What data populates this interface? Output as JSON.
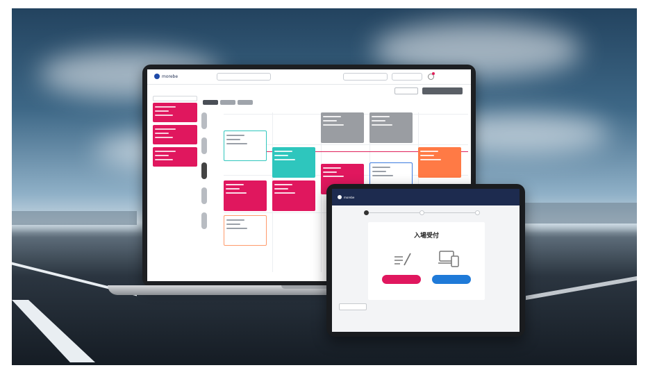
{
  "laptop_app": {
    "brand": "morebe",
    "header": {
      "date": "",
      "select_1": "",
      "select_2": "",
      "user": ""
    },
    "sidebar": {
      "title": ""
    },
    "main": {
      "title": "",
      "link": "",
      "btn_1": "",
      "btn_2": "",
      "link_right": ""
    },
    "day_headers": [
      "",
      "",
      "",
      "",
      ""
    ],
    "time_labels": [
      "",
      "",
      "",
      ""
    ]
  },
  "tablet_app": {
    "brand": "morebe",
    "nav": [
      "",
      ""
    ],
    "steps": [
      "",
      "",
      ""
    ],
    "title": "入場受付",
    "subtitle": "",
    "buttons": {
      "primary": "",
      "secondary": ""
    },
    "back": ""
  },
  "colors": {
    "brand_navy": "#1d2b4f",
    "accent_pink": "#e0175e",
    "accent_teal": "#2ec6bd",
    "accent_orange": "#ff7a45",
    "accent_blue": "#1f7ad8",
    "event_gray": "#9a9da2"
  },
  "icons": [
    "bell-icon",
    "form-pen-icon",
    "devices-icon",
    "logo-icon"
  ]
}
